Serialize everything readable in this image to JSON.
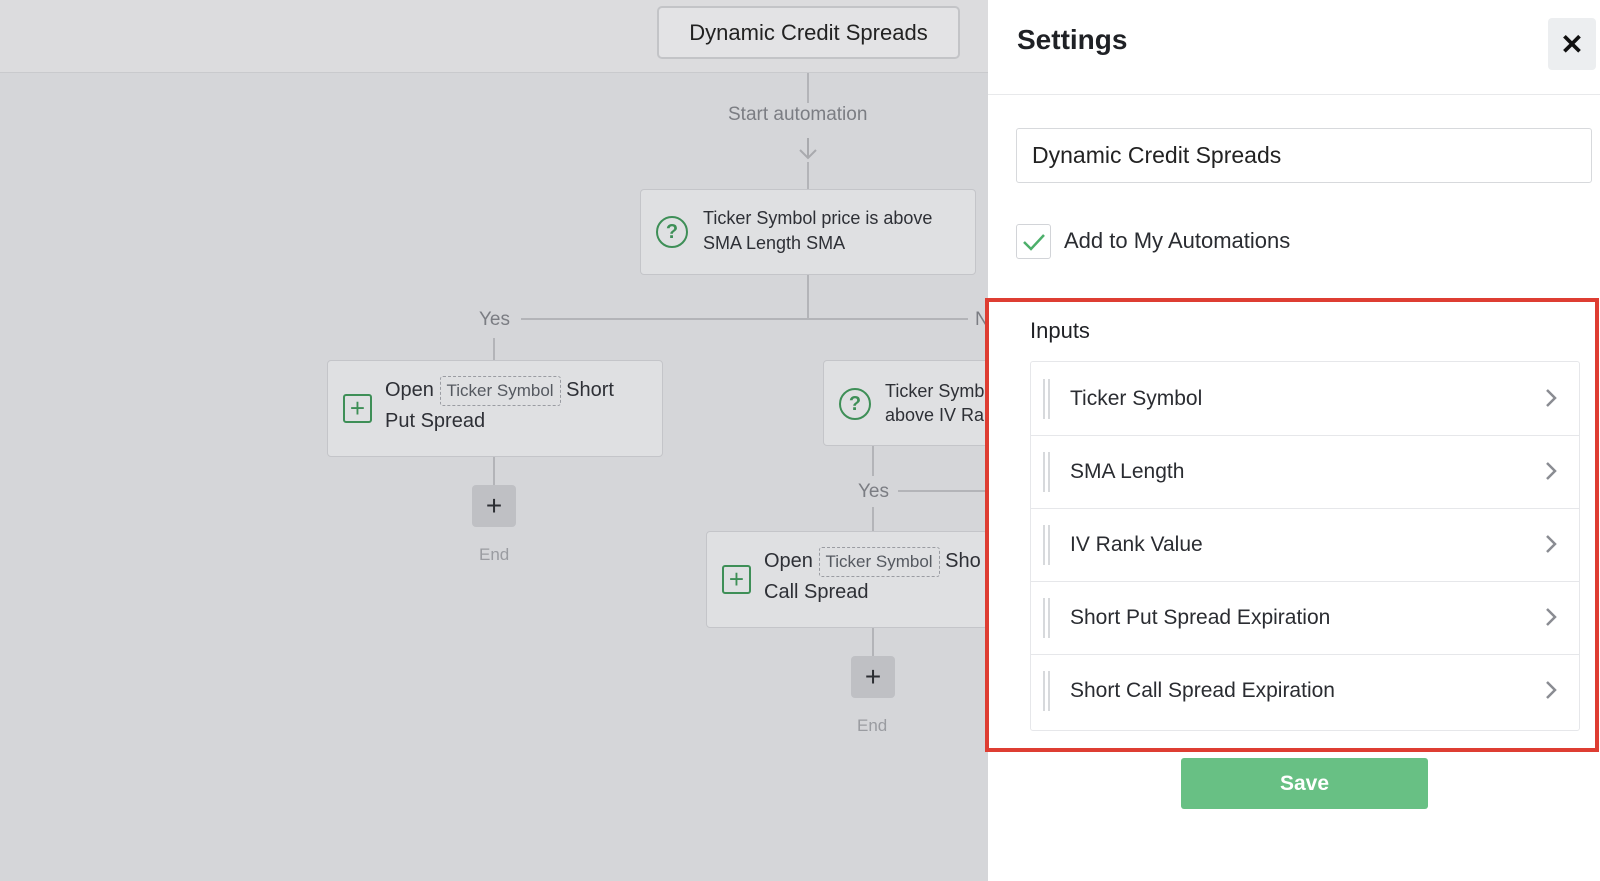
{
  "canvas": {
    "automation_title": "Dynamic Credit Spreads",
    "start_label": "Start automation",
    "condition1_text": "Ticker Symbol price is above SMA Length SMA",
    "yes_label": "Yes",
    "no_label_partial": "N",
    "action1": {
      "prefix": "Open",
      "pill": "Ticker Symbol",
      "suffix_line1": "Short",
      "line2": "Put Spread"
    },
    "condition2_line1": "Ticker Symb",
    "condition2_line2": "above IV Ra",
    "yes_label2": "Yes",
    "action2": {
      "prefix": "Open",
      "pill": "Ticker Symbol",
      "suffix_line1": "Sho",
      "line2": "Call Spread"
    },
    "add_symbol": "+",
    "end_label": "End"
  },
  "settings": {
    "title": "Settings",
    "close_symbol": "✕",
    "name_value": "Dynamic Credit Spreads",
    "add_to_my_automations": "Add to My Automations",
    "checkbox_checked": true,
    "inputs_title": "Inputs",
    "inputs": [
      {
        "label": "Ticker Symbol"
      },
      {
        "label": "SMA Length"
      },
      {
        "label": "IV Rank Value"
      },
      {
        "label": "Short Put Spread Expiration"
      },
      {
        "label": "Short Call Spread Expiration"
      }
    ],
    "save_label": "Save"
  },
  "colors": {
    "accent_green": "#68c084",
    "icon_green": "#3e8f57",
    "highlight_red": "#de3d32"
  }
}
